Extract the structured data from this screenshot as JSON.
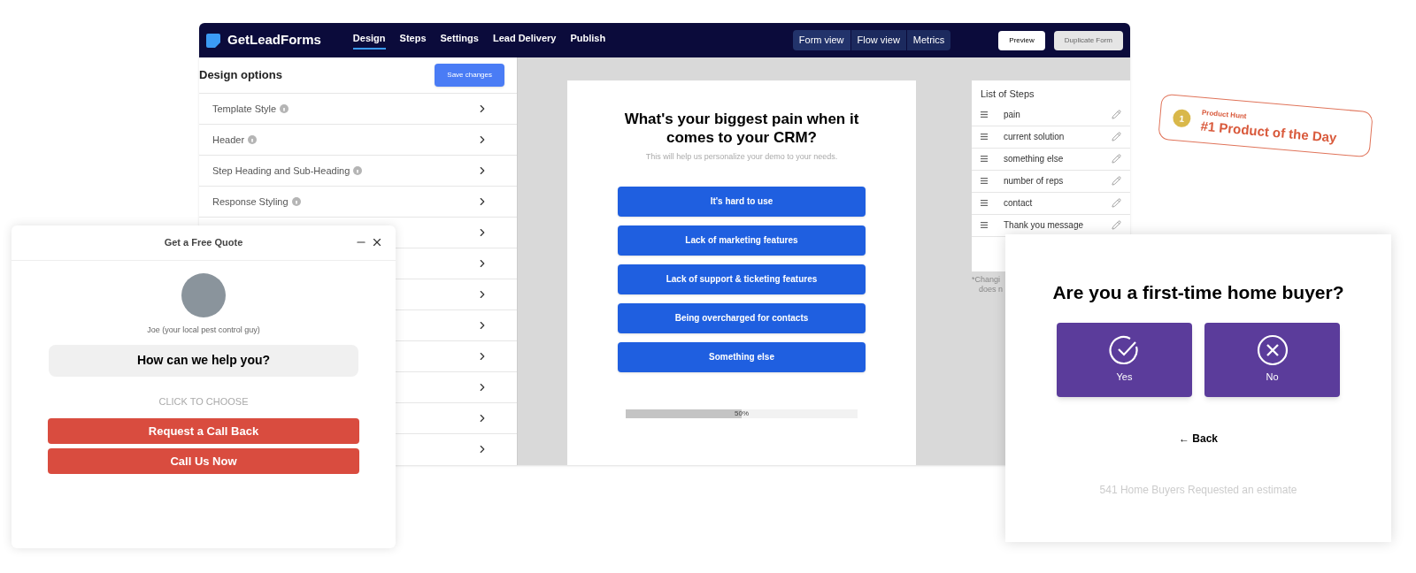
{
  "app_window": {
    "logo": "GetLeadForms",
    "nav_tabs": [
      {
        "label": "Design",
        "selected": true
      },
      {
        "label": "Steps",
        "selected": false
      },
      {
        "label": "Settings",
        "selected": false
      },
      {
        "label": "Lead Delivery",
        "selected": false
      },
      {
        "label": "Publish",
        "selected": false
      }
    ],
    "view_switch": [
      {
        "label": "Form view",
        "selected": true
      },
      {
        "label": "Flow view",
        "selected": false
      },
      {
        "label": "Metrics",
        "selected": false
      }
    ],
    "buttons": [
      {
        "label": "Preview",
        "kind": "primary"
      },
      {
        "label": "Duplicate Form",
        "kind": "secondary"
      }
    ]
  },
  "design_panel": {
    "title": "Design options",
    "save_button": "Save changes",
    "options": [
      {
        "label": "Template Style",
        "help_icon": true
      },
      {
        "label": "Header",
        "help_icon": true
      },
      {
        "label": "Step Heading and Sub-Heading",
        "help_icon": true
      },
      {
        "label": "Response Styling",
        "help_icon": true
      },
      {
        "help_icon": false
      },
      {
        "help_icon": false
      },
      {
        "help_icon": false
      },
      {
        "help_icon": false
      },
      {
        "help_icon": false
      },
      {
        "help_icon": false
      },
      {
        "help_icon": false
      },
      {
        "help_icon": false
      }
    ]
  },
  "form_preview": {
    "heading": "What's your biggest pain when it comes to your CRM?",
    "subheading": "This will help us personalize your demo to your needs.",
    "answers": [
      "It's hard to use",
      "Lack of marketing features",
      "Lack of support & ticketing features",
      "Being overcharged for contacts",
      "Something else"
    ],
    "progress": {
      "level": 0.5,
      "reading": "50%"
    }
  },
  "steps_panel": {
    "title": "List of Steps",
    "steps": [
      "pain",
      "current solution",
      "something else",
      "number of reps",
      "contact",
      "Thank you message"
    ],
    "note_lines": [
      "*Changi",
      "does n"
    ]
  },
  "chat_widget": {
    "title": "Get a Free Quote",
    "agent_name": "Joe (your local pest control guy)",
    "question": "How can we help you?",
    "prompt": "CLICK TO CHOOSE",
    "buttons": [
      "Request a Call Back",
      "Call Us Now"
    ]
  },
  "product_hunt_badge": {
    "rank": "1",
    "label": "Product Hunt",
    "title": "#1 Product of the Day"
  },
  "home_buyer_card": {
    "question": "Are you a first-time home buyer?",
    "options": [
      {
        "label": "Yes",
        "kind": "check"
      },
      {
        "label": "No",
        "kind": "cross"
      }
    ],
    "back_link": "← Back",
    "social_proof": "541 Home Buyers Requested an estimate"
  }
}
